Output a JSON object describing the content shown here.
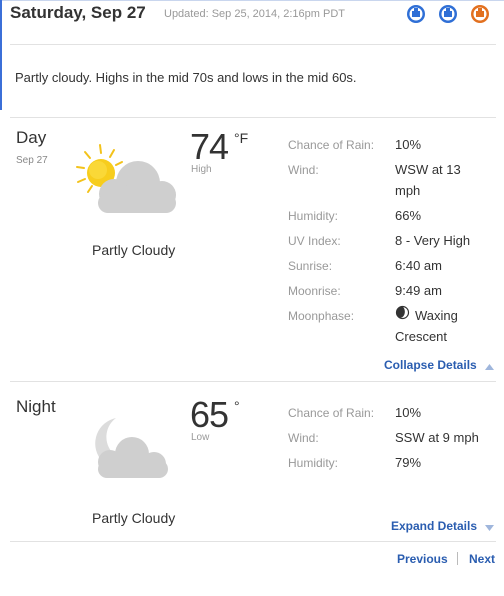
{
  "header": {
    "date": "Saturday, Sep 27",
    "updated": "Updated: Sep 25, 2014, 2:16pm PDT",
    "share_icons": [
      "share-icon-1",
      "share-icon-2",
      "share-icon-3"
    ],
    "colors": {
      "share_blue": "#2f6fd6",
      "share_orange": "#e2701f",
      "accent": "#3b6fd8"
    }
  },
  "summary": "Partly cloudy. Highs in the mid 70s and lows in the mid 60s.",
  "day": {
    "label": "Day",
    "date": "Sep 27",
    "temp": "74",
    "unit": "°F",
    "temp_label": "High",
    "condition": "Partly Cloudy",
    "icon": "sun-cloud-icon",
    "details": [
      {
        "key": "Chance of Rain:",
        "value": "10%"
      },
      {
        "key": "Wind:",
        "value": "WSW at 13 mph"
      },
      {
        "key": "Humidity:",
        "value": "66%"
      },
      {
        "key": "UV Index:",
        "value": "8 - Very High"
      },
      {
        "key": "Sunrise:",
        "value": "6:40 am"
      },
      {
        "key": "Moonrise:",
        "value": "9:49 am"
      },
      {
        "key": "Moonphase:",
        "value": "Waxing Crescent",
        "icon": "moon-phase-icon"
      }
    ],
    "toggle_label": "Collapse Details"
  },
  "night": {
    "label": "Night",
    "temp": "65",
    "unit": "°",
    "temp_label": "Low",
    "condition": "Partly Cloudy",
    "icon": "moon-cloud-icon",
    "details": [
      {
        "key": "Chance of Rain:",
        "value": "10%"
      },
      {
        "key": "Wind:",
        "value": "SSW at 9 mph"
      },
      {
        "key": "Humidity:",
        "value": "79%"
      }
    ],
    "toggle_label": "Expand Details"
  },
  "pager": {
    "previous": "Previous",
    "next": "Next"
  }
}
